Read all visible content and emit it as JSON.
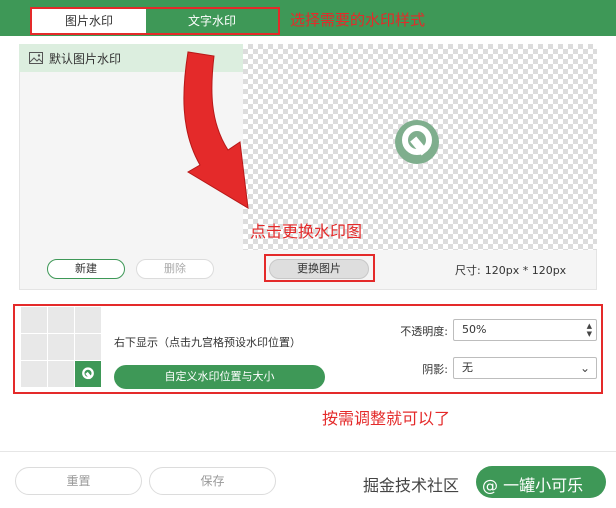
{
  "tabs": {
    "image_watermark": "图片水印",
    "text_watermark": "文字水印"
  },
  "annotations": {
    "top": "选择需要的水印样式",
    "middle": "点击更换水印图",
    "bottom": "按需调整就可以了"
  },
  "list": {
    "default_item": "默认图片水印"
  },
  "buttons": {
    "new": "新建",
    "delete": "删除",
    "replace": "更换图片",
    "custom_position": "自定义水印位置与大小",
    "reset": "重置",
    "save": "保存"
  },
  "size": {
    "label": "尺寸:",
    "value": "120px * 120px"
  },
  "position": {
    "text": "右下显示（点击九宫格预设水印位置）",
    "grid_selected": "bottom-right"
  },
  "opacity": {
    "label": "不透明度:",
    "value": "50%"
  },
  "shadow": {
    "label": "阴影:",
    "value": "无"
  },
  "footer_watermark": {
    "site": "掘金技术社区",
    "author": "@ 一罐小可乐"
  },
  "colors": {
    "brand_green": "#3e9857",
    "annotation_red": "#e42a2a"
  }
}
